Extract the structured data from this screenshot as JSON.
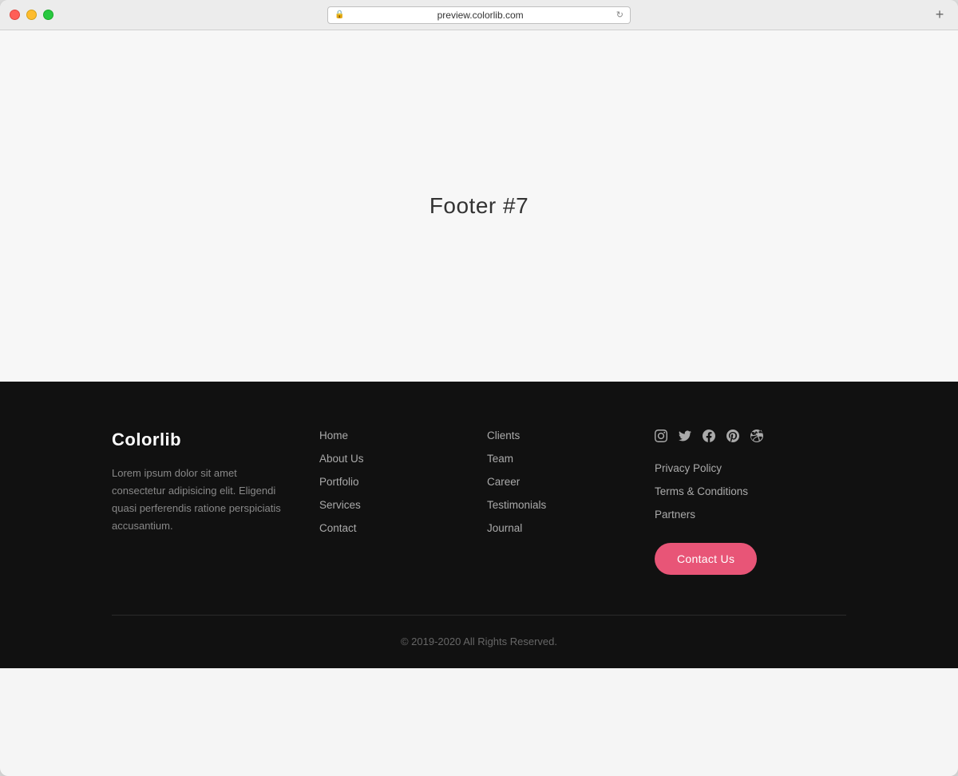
{
  "browser": {
    "url": "preview.colorlib.com",
    "new_tab_icon": "+"
  },
  "page": {
    "title": "Footer #7"
  },
  "footer": {
    "brand": {
      "name": "Colorlib",
      "description": "Lorem ipsum dolor sit amet consectetur adipisicing elit. Eligendi quasi perferendis ratione perspiciatis accusantium."
    },
    "col1": {
      "links": [
        "Home",
        "About Us",
        "Portfolio",
        "Services",
        "Contact"
      ]
    },
    "col2": {
      "links": [
        "Clients",
        "Team",
        "Career",
        "Testimonials",
        "Journal"
      ]
    },
    "legal": {
      "links": [
        "Privacy Policy",
        "Terms & Conditions",
        "Partners"
      ]
    },
    "social": {
      "icons": [
        "instagram",
        "twitter",
        "facebook",
        "pinterest",
        "dribbble"
      ]
    },
    "contact_btn": "Contact Us",
    "copyright": "© 2019-2020 All Rights Reserved."
  }
}
